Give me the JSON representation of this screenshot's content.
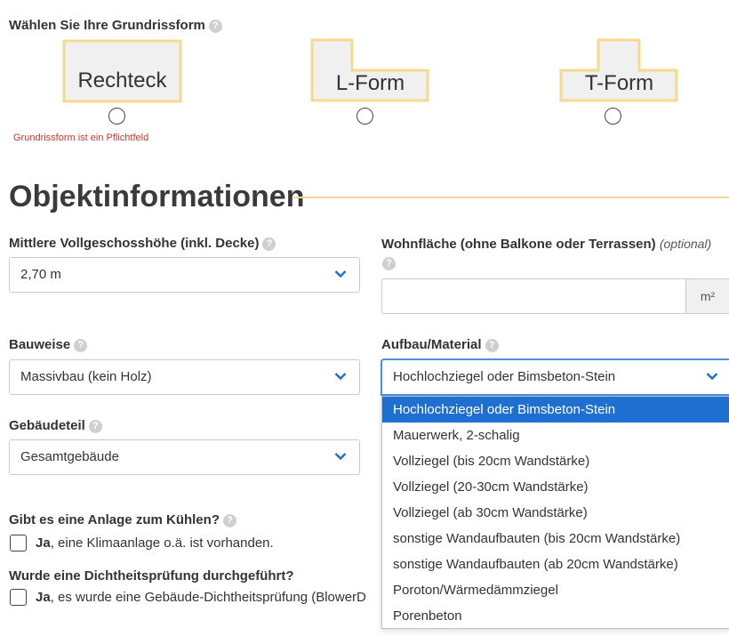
{
  "grundriss": {
    "label": "Wählen Sie Ihre Grundrissform",
    "help_icon": "?",
    "shapes": [
      {
        "label": "Rechteck"
      },
      {
        "label": "L-Form"
      },
      {
        "label": "T-Form"
      }
    ],
    "error": "Grundrissform ist ein Pflichtfeld",
    "shape_fill": "#f0f0f0",
    "shape_border": "#f5d98c"
  },
  "section": {
    "title": "Objektinformationen",
    "accent": "#f5d98c"
  },
  "fields": {
    "geschosshoehe": {
      "label": "Mittlere Vollgeschosshöhe (inkl. Decke)",
      "value": "2,70 m"
    },
    "wohnflaeche": {
      "label": "Wohnfläche (ohne Balkone oder Terrassen)",
      "optional": "(optional)",
      "value": "",
      "unit": "m²"
    },
    "bauweise": {
      "label": "Bauweise",
      "value": "Massivbau (kein Holz)"
    },
    "aufbau": {
      "label": "Aufbau/Material",
      "value": "Hochlochziegel oder Bimsbeton-Stein",
      "options": [
        "Hochlochziegel oder Bimsbeton-Stein",
        "Mauerwerk, 2-schalig",
        "Vollziegel (bis 20cm Wandstärke)",
        "Vollziegel (20-30cm Wandstärke)",
        "Vollziegel (ab 30cm Wandstärke)",
        "sonstige Wandaufbauten (bis 20cm Wandstärke)",
        "sonstige Wandaufbauten (ab 20cm Wandstärke)",
        "Poroton/Wärmedämmziegel",
        "Porenbeton"
      ]
    },
    "gebaeudeteil": {
      "label": "Gebäudeteil",
      "value": "Gesamtgebäude"
    }
  },
  "kuehlung": {
    "label": "Gibt es eine Anlage zum Kühlen?",
    "checkbox_bold": "Ja",
    "checkbox_text": ", eine Klimaanlage o.ä. ist vorhanden."
  },
  "dichtheit": {
    "label": "Wurde eine Dichtheitsprüfung durchgeführt?",
    "checkbox_bold": "Ja",
    "checkbox_text": ", es wurde eine Gebäude-Dichtheitsprüfung (BlowerD"
  },
  "colors": {
    "selected_option": "#1f6fd1",
    "chevron": "#1f6fd1",
    "error": "#c0392b"
  }
}
